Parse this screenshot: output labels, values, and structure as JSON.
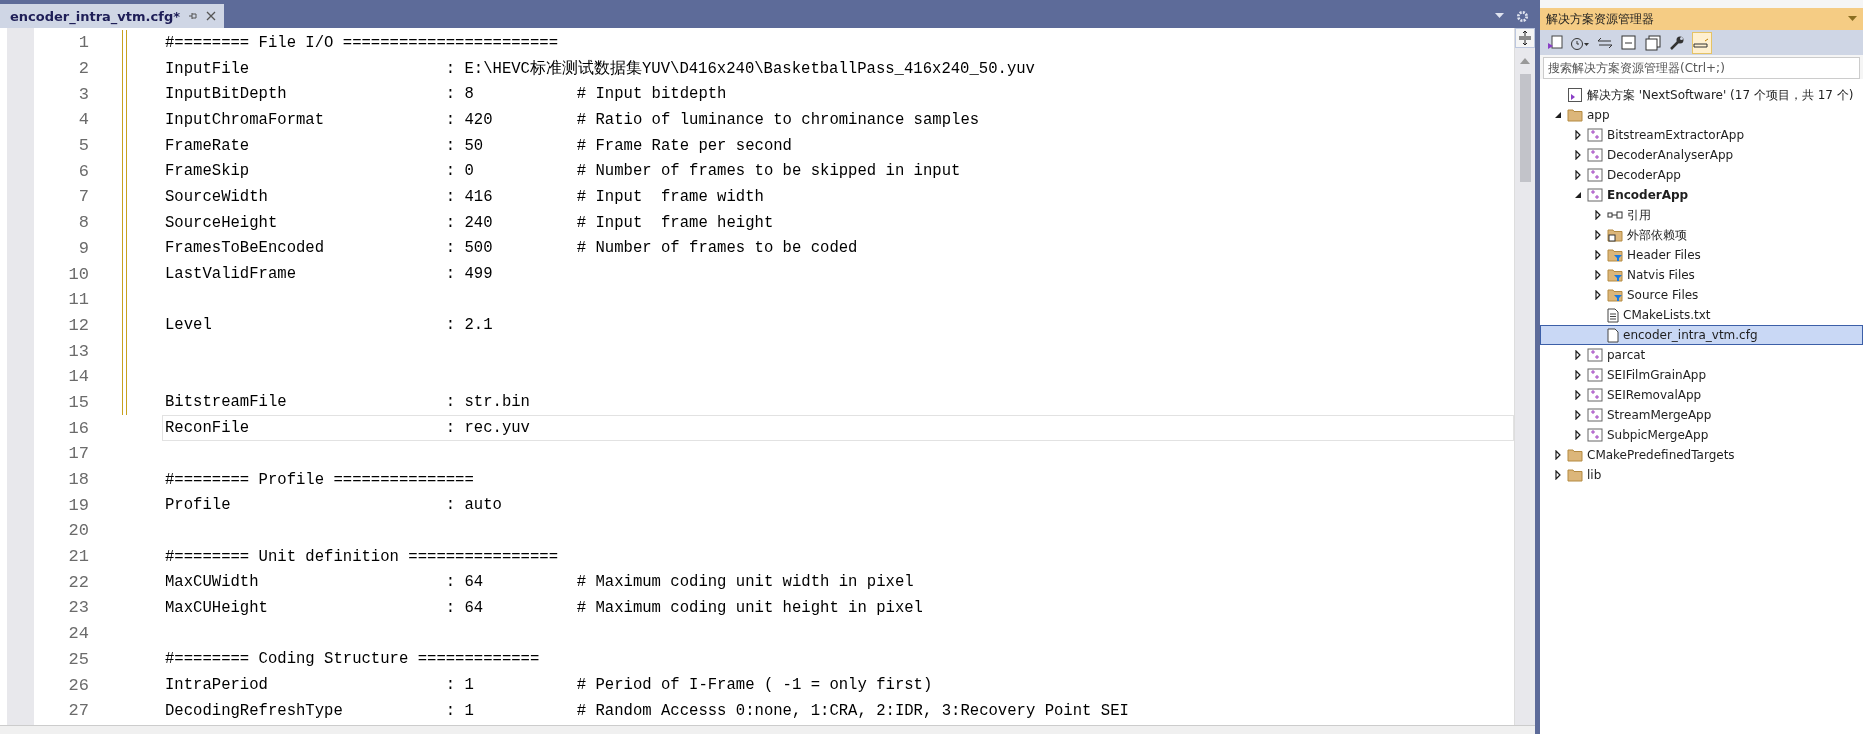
{
  "editor": {
    "tab": {
      "title": "encoder_intra_vtm.cfg*",
      "selected": true
    },
    "lines": [
      {
        "number": "1",
        "text": "#======== File I/O =======================",
        "changed": true,
        "current": false
      },
      {
        "number": "2",
        "text": "InputFile                     : E:\\HEVC标准测试数据集YUV\\D416x240\\BasketballPass_416x240_50.yuv",
        "changed": true,
        "current": false
      },
      {
        "number": "3",
        "text": "InputBitDepth                 : 8           # Input bitdepth",
        "changed": true,
        "current": false
      },
      {
        "number": "4",
        "text": "InputChromaFormat             : 420         # Ratio of luminance to chrominance samples",
        "changed": true,
        "current": false
      },
      {
        "number": "5",
        "text": "FrameRate                     : 50          # Frame Rate per second",
        "changed": true,
        "current": false
      },
      {
        "number": "6",
        "text": "FrameSkip                     : 0           # Number of frames to be skipped in input",
        "changed": true,
        "current": false
      },
      {
        "number": "7",
        "text": "SourceWidth                   : 416         # Input  frame width",
        "changed": true,
        "current": false
      },
      {
        "number": "8",
        "text": "SourceHeight                  : 240         # Input  frame height",
        "changed": true,
        "current": false
      },
      {
        "number": "9",
        "text": "FramesToBeEncoded             : 500         # Number of frames to be coded",
        "changed": true,
        "current": false
      },
      {
        "number": "10",
        "text": "LastValidFrame                : 499",
        "changed": true,
        "current": false
      },
      {
        "number": "11",
        "changed": true,
        "current": false
      },
      {
        "number": "12",
        "text": "Level                         : 2.1",
        "changed": true,
        "current": false
      },
      {
        "number": "13",
        "changed": true,
        "current": false
      },
      {
        "number": "14",
        "changed": true,
        "current": false
      },
      {
        "number": "15",
        "text": "BitstreamFile                 : str.bin",
        "changed": true,
        "current": false
      },
      {
        "number": "16",
        "text": "ReconFile                     : rec.yuv",
        "changed": false,
        "current": true
      },
      {
        "number": "17",
        "changed": false,
        "current": false
      },
      {
        "number": "18",
        "text": "#======== Profile ===============",
        "changed": false,
        "current": false
      },
      {
        "number": "19",
        "text": "Profile                       : auto",
        "changed": false,
        "current": false
      },
      {
        "number": "20",
        "changed": false,
        "current": false
      },
      {
        "number": "21",
        "text": "#======== Unit definition ================",
        "changed": false,
        "current": false
      },
      {
        "number": "22",
        "text": "MaxCUWidth                    : 64          # Maximum coding unit width in pixel",
        "changed": false,
        "current": false
      },
      {
        "number": "23",
        "text": "MaxCUHeight                   : 64          # Maximum coding unit height in pixel",
        "changed": false,
        "current": false
      },
      {
        "number": "24",
        "changed": false,
        "current": false
      },
      {
        "number": "25",
        "text": "#======== Coding Structure =============",
        "changed": false,
        "current": false
      },
      {
        "number": "26",
        "text": "IntraPeriod                   : 1           # Period of I-Frame ( -1 = only first)",
        "changed": false,
        "current": false
      },
      {
        "number": "27",
        "text": "DecodingRefreshType           : 1           # Random Accesss 0:none, 1:CRA, 2:IDR, 3:Recovery Point SEI",
        "changed": false,
        "current": false
      }
    ]
  },
  "solution_explorer": {
    "title": "解决方案资源管理器",
    "search": {
      "placeholder": "搜索解决方案资源管理器(Ctrl+;)"
    },
    "tree": [
      {
        "kind": "solution",
        "label": "解决方案 'NextSoftware' (17 个项目，共 17 个)",
        "selected": false,
        "children": [
          {
            "kind": "folder",
            "label": "app",
            "expanded": true,
            "selected": false,
            "children": [
              {
                "kind": "project",
                "label": "BitstreamExtractorApp",
                "expanded": false,
                "selected": false
              },
              {
                "kind": "project",
                "label": "DecoderAnalyserApp",
                "expanded": false,
                "selected": false
              },
              {
                "kind": "project",
                "label": "DecoderApp",
                "expanded": false,
                "selected": false
              },
              {
                "kind": "project",
                "label": "EncoderApp",
                "bold": true,
                "expanded": true,
                "selected": false,
                "children": [
                  {
                    "kind": "reference",
                    "label": "引用",
                    "expanded": false,
                    "selected": false
                  },
                  {
                    "kind": "deps",
                    "label": "外部依赖项",
                    "expanded": false,
                    "selected": false
                  },
                  {
                    "kind": "filter",
                    "label": "Header Files",
                    "expanded": false,
                    "selected": false
                  },
                  {
                    "kind": "filter",
                    "label": "Natvis Files",
                    "expanded": false,
                    "selected": false
                  },
                  {
                    "kind": "filter",
                    "label": "Source Files",
                    "expanded": false,
                    "selected": false
                  },
                  {
                    "kind": "textfile",
                    "label": "CMakeLists.txt",
                    "selected": false
                  },
                  {
                    "kind": "file",
                    "label": "encoder_intra_vtm.cfg",
                    "selected": true
                  }
                ]
              },
              {
                "kind": "project",
                "label": "parcat",
                "expanded": false,
                "selected": false
              },
              {
                "kind": "project",
                "label": "SEIFilmGrainApp",
                "expanded": false,
                "selected": false
              },
              {
                "kind": "project",
                "label": "SEIRemovalApp",
                "expanded": false,
                "selected": false
              },
              {
                "kind": "project",
                "label": "StreamMergeApp",
                "expanded": false,
                "selected": false
              },
              {
                "kind": "project",
                "label": "SubpicMergeApp",
                "expanded": false,
                "selected": false
              }
            ]
          },
          {
            "kind": "folder",
            "label": "CMakePredefinedTargets",
            "expanded": false,
            "selected": false
          },
          {
            "kind": "folder",
            "label": "lib",
            "expanded": false,
            "selected": false
          }
        ]
      }
    ]
  }
}
